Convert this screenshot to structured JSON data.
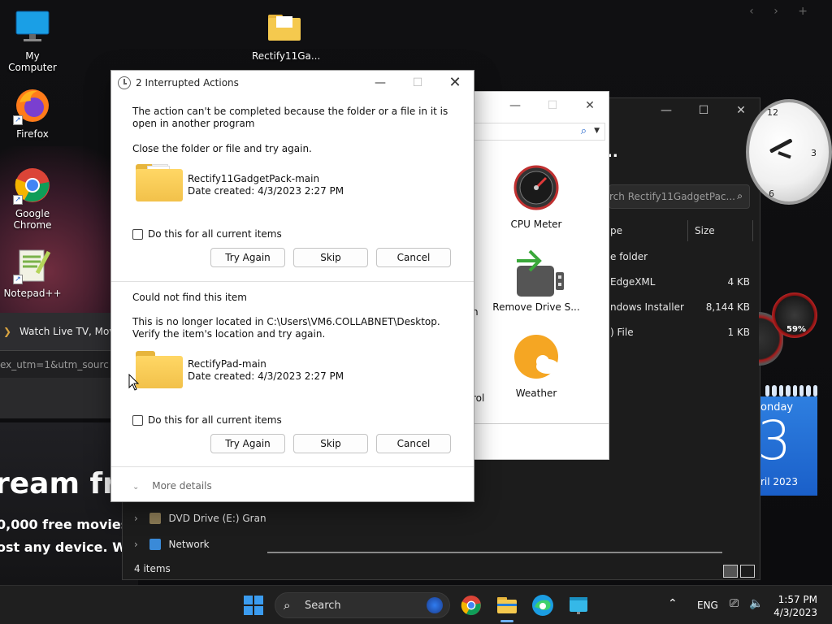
{
  "desktop": {
    "icons": [
      {
        "label": "My Computer"
      },
      {
        "label": "Rectify11Ga..."
      },
      {
        "label": "Firefox"
      },
      {
        "label": "Google Chrome"
      },
      {
        "label": "Notepad++"
      }
    ],
    "browser": {
      "tab_title": "Watch Live TV, Movie",
      "url_fragment": "ex_utm=1&utm_sourc",
      "promo_title": "ream fre",
      "promo_line1": "0,000 free movies",
      "promo_line2": "ost any device. What"
    }
  },
  "dark_explorer": {
    "search_placeholder": "rch Rectify11GadgetPac...",
    "columns": {
      "type": "pe",
      "size": "Size"
    },
    "rows": [
      {
        "type": "e folder",
        "size": ""
      },
      {
        "type": "EdgeXML",
        "size": "4 KB"
      },
      {
        "type": "ndows Installer ...",
        "size": "8,144 KB"
      },
      {
        "type": ") File",
        "size": "1 KB"
      }
    ],
    "nav": [
      {
        "label": "DVD Drive (E:) Gran"
      },
      {
        "label": "Network"
      }
    ],
    "status": "4 items"
  },
  "light_explorer": {
    "gadgets": [
      {
        "label": "CPU Meter"
      },
      {
        "label": "Remove Drive S..."
      },
      {
        "label": "Weather"
      }
    ],
    "cut_labels": [
      "n",
      "rol"
    ]
  },
  "right_gadgets": {
    "clock_numbers": {
      "twelve": "12",
      "three": "3",
      "six": "6"
    },
    "meter_percent": "59%",
    "calendar": {
      "day_name": "onday",
      "day_number": "3",
      "month_year": "ril 2023"
    }
  },
  "dialog": {
    "title": "2 Interrupted Actions",
    "section1": {
      "message": "The action can't be completed because the folder or a file in it is open in another program",
      "instruction": "Close the folder or file and try again.",
      "file_name": "Rectify11GadgetPack-main",
      "file_date": "Date created: 4/3/2023 2:27 PM",
      "checkbox_label": "Do this for all current items",
      "btn_try": "Try Again",
      "btn_skip": "Skip",
      "btn_cancel": "Cancel"
    },
    "section2": {
      "heading": "Could not find this item",
      "message": "This is no longer located in C:\\Users\\VM6.COLLABNET\\Desktop. Verify the item's location and try again.",
      "file_name": "RectifyPad-main",
      "file_date": "Date created: 4/3/2023 2:27 PM",
      "checkbox_label": "Do this for all current items",
      "btn_try": "Try Again",
      "btn_skip": "Skip",
      "btn_cancel": "Cancel"
    },
    "more_details": "More details"
  },
  "taskbar": {
    "search_label": "Search",
    "lang": "ENG",
    "time": "1:57 PM",
    "date": "4/3/2023"
  },
  "colors": {
    "accent": "#3b9cf0",
    "folder": "#f2c14a",
    "taskbar_bg": "#1f1f1f"
  }
}
